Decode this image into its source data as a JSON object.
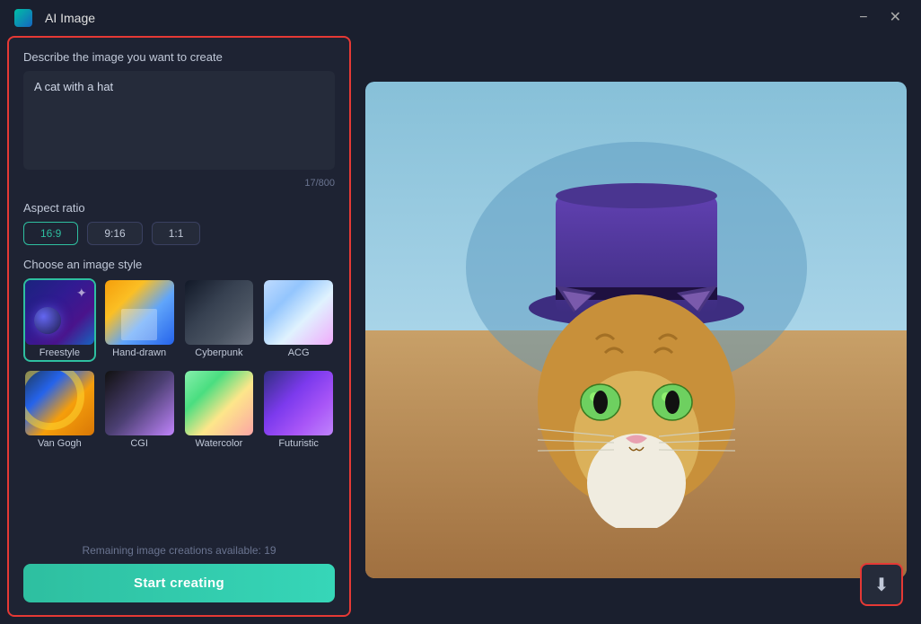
{
  "window": {
    "title": "AI Image",
    "minimize_label": "−",
    "close_label": "✕"
  },
  "left_panel": {
    "prompt_label": "Describe the image you want to create",
    "prompt_value": "A cat with a hat",
    "char_count": "17/800",
    "aspect_ratio_label": "Aspect ratio",
    "aspect_options": [
      {
        "label": "16:9",
        "active": true
      },
      {
        "label": "9:16",
        "active": false
      },
      {
        "label": "1:1",
        "active": false
      }
    ],
    "style_label": "Choose an image style",
    "styles": [
      {
        "id": "freestyle",
        "label": "Freestyle",
        "active": true
      },
      {
        "id": "handdrawn",
        "label": "Hand-drawn",
        "active": false
      },
      {
        "id": "cyberpunk",
        "label": "Cyberpunk",
        "active": false
      },
      {
        "id": "acg",
        "label": "ACG",
        "active": false
      },
      {
        "id": "vangogh",
        "label": "Van Gogh",
        "active": false
      },
      {
        "id": "cgi",
        "label": "CGI",
        "active": false
      },
      {
        "id": "watercolor",
        "label": "Watercolor",
        "active": false
      },
      {
        "id": "futuristic",
        "label": "Futuristic",
        "active": false
      }
    ],
    "remaining_text": "Remaining image creations available: 19",
    "start_btn_label": "Start creating"
  },
  "right_panel": {
    "image_alt": "AI generated cat with a hat",
    "download_icon": "⬇"
  }
}
